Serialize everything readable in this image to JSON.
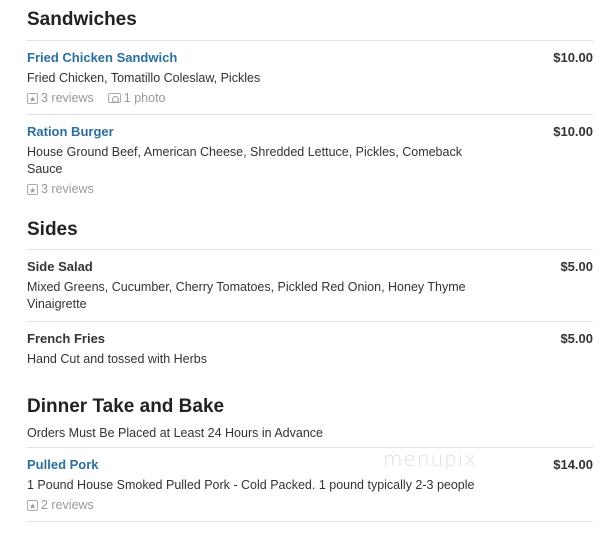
{
  "sections": [
    {
      "title": "Sandwiches",
      "items": [
        {
          "name": "Fried Chicken Sandwich",
          "price": "$10.00",
          "description": "Fried Chicken, Tomatillo Coleslaw, Pickles",
          "reviews": "3 reviews",
          "photos": "1 photo"
        },
        {
          "name": "Ration Burger",
          "price": "$10.00",
          "description": "House Ground Beef, American Cheese, Shredded Lettuce, Pickles, Comeback Sauce",
          "reviews": "3 reviews"
        }
      ]
    },
    {
      "title": "Sides",
      "items": [
        {
          "name": "Side Salad",
          "price": "$5.00",
          "description": "Mixed Greens, Cucumber, Cherry Tomatoes, Pickled Red Onion, Honey Thyme Vinaigrette"
        },
        {
          "name": "French Fries",
          "price": "$5.00",
          "description": "Hand Cut and tossed with Herbs"
        }
      ]
    },
    {
      "title": "Dinner Take and Bake",
      "description": "Orders Must Be Placed at Least 24 Hours in Advance",
      "items": [
        {
          "name": "Pulled Pork",
          "price": "$14.00",
          "description": "1 Pound House Smoked Pulled Pork - Cold Packed. 1 pound typically 2-3 people",
          "reviews": "2 reviews"
        }
      ]
    }
  ],
  "watermark": "menupix",
  "colors": {
    "link": "#2a6fa0",
    "muted": "#999999",
    "divider": "#e2e2e2"
  }
}
